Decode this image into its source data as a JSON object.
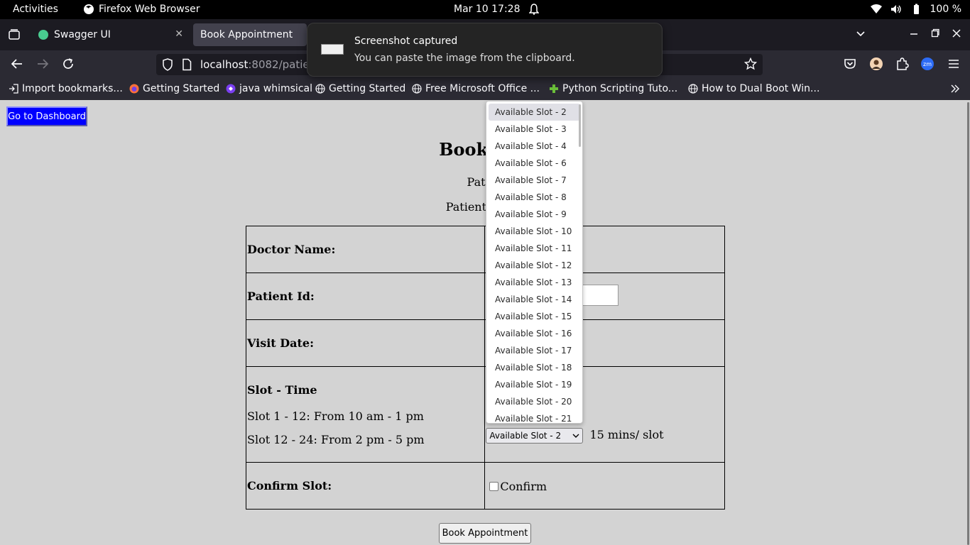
{
  "system_bar": {
    "activities": "Activities",
    "app_name": "Firefox Web Browser",
    "clock": "Mar 10  17:28",
    "battery": "100 %"
  },
  "browser": {
    "tabs": [
      {
        "label": "Swagger UI",
        "icon": "swagger-icon",
        "active": false
      },
      {
        "label": "Book Appointment",
        "active": true
      }
    ],
    "url": {
      "host": "localhost",
      "rest": ":8082/patien"
    },
    "bookmarks": [
      {
        "label": "Import bookmarks...",
        "icon": "import-icon"
      },
      {
        "label": "Getting Started",
        "icon": "firefox-icon"
      },
      {
        "label": "java whimsical",
        "icon": "whimsical-icon"
      },
      {
        "label": "Getting Started",
        "icon": "globe-icon"
      },
      {
        "label": "Free Microsoft Office ...",
        "icon": "globe-icon"
      },
      {
        "label": "Python Scripting Tuto...",
        "icon": "python-icon"
      },
      {
        "label": "How to Dual Boot Win...",
        "icon": "globe-icon"
      }
    ]
  },
  "notification": {
    "title": "Screenshot captured",
    "body": "You can paste the image from the clipboard."
  },
  "page": {
    "dashboard_button": "Go to Dashboard",
    "title": "Book App",
    "patient_line1": "Patien",
    "patient_line2": "Patient Name",
    "form": {
      "doctor_label": "Doctor Name:",
      "patient_id_label": "Patient Id:",
      "visit_date_label": "Visit Date:",
      "slot_time_label": "Slot - Time",
      "slot_info_1": "Slot 1 - 12: From 10 am - 1 pm",
      "slot_info_2": "Slot 12 - 24: From 2 pm - 5 pm",
      "slot_selected": "Available Slot - 2",
      "slot_unit": "15 mins/ slot",
      "confirm_label": "Confirm Slot:",
      "confirm_checkbox_label": "Confirm",
      "confirm_checked": false
    },
    "book_button": "Book Appointment"
  },
  "dropdown": {
    "options": [
      "Available Slot - 2",
      "Available Slot - 3",
      "Available Slot - 4",
      "Available Slot - 6",
      "Available Slot - 7",
      "Available Slot - 8",
      "Available Slot - 9",
      "Available Slot - 10",
      "Available Slot - 11",
      "Available Slot - 12",
      "Available Slot - 13",
      "Available Slot - 14",
      "Available Slot - 15",
      "Available Slot - 16",
      "Available Slot - 17",
      "Available Slot - 18",
      "Available Slot - 19",
      "Available Slot - 20",
      "Available Slot - 21"
    ],
    "highlighted_index": 0
  }
}
